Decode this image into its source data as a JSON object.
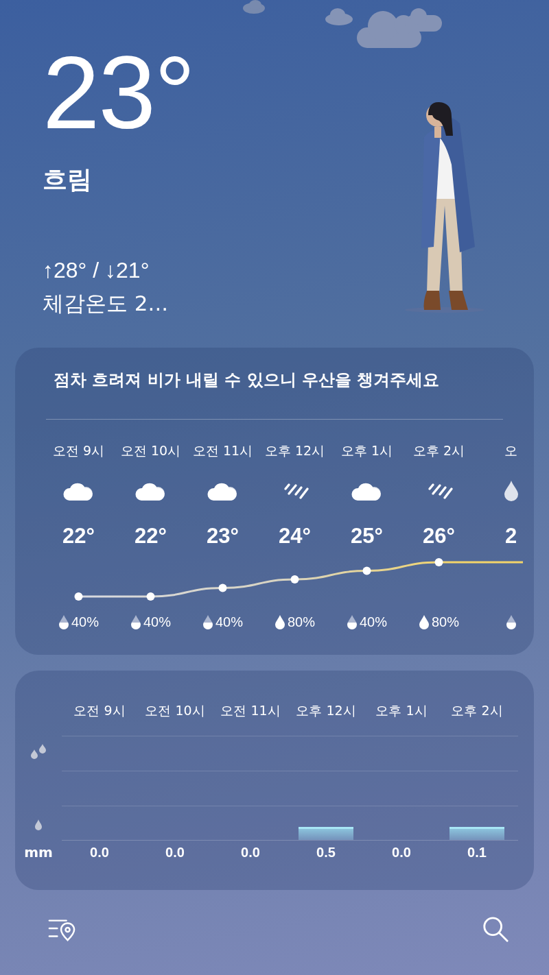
{
  "current": {
    "temperature": "23°",
    "condition": "흐림",
    "high_low": "↑28° / ↓21°",
    "feels_like": "체감온도 2..."
  },
  "forecast_card": {
    "message": "점차 흐려져 비가 내릴 수 있으니 우산을 챙겨주세요",
    "hours": [
      {
        "time": "오전 9시",
        "kind": "cloud",
        "temp": "22°",
        "drop_full": false,
        "precip": "40%"
      },
      {
        "time": "오전 10시",
        "kind": "cloud",
        "temp": "22°",
        "drop_full": false,
        "precip": "40%"
      },
      {
        "time": "오전 11시",
        "kind": "cloud",
        "temp": "23°",
        "drop_full": false,
        "precip": "40%"
      },
      {
        "time": "오후 12시",
        "kind": "rain",
        "temp": "24°",
        "drop_full": true,
        "precip": "80%"
      },
      {
        "time": "오후 1시",
        "kind": "cloud",
        "temp": "25°",
        "drop_full": false,
        "precip": "40%"
      },
      {
        "time": "오후 2시",
        "kind": "rain",
        "temp": "26°",
        "drop_full": true,
        "precip": "80%"
      },
      {
        "time": "오",
        "kind": "drop",
        "temp": "2",
        "drop_full": false
      }
    ]
  },
  "precip_card": {
    "unit": "mm",
    "hours": [
      {
        "time": "오전 9시",
        "amount": "0.0"
      },
      {
        "time": "오전 10시",
        "amount": "0.0"
      },
      {
        "time": "오전 11시",
        "amount": "0.0"
      },
      {
        "time": "오후 12시",
        "amount": "0.5"
      },
      {
        "time": "오후 1시",
        "amount": "0.0"
      },
      {
        "time": "오후 2시",
        "amount": "0.1"
      }
    ]
  }
}
